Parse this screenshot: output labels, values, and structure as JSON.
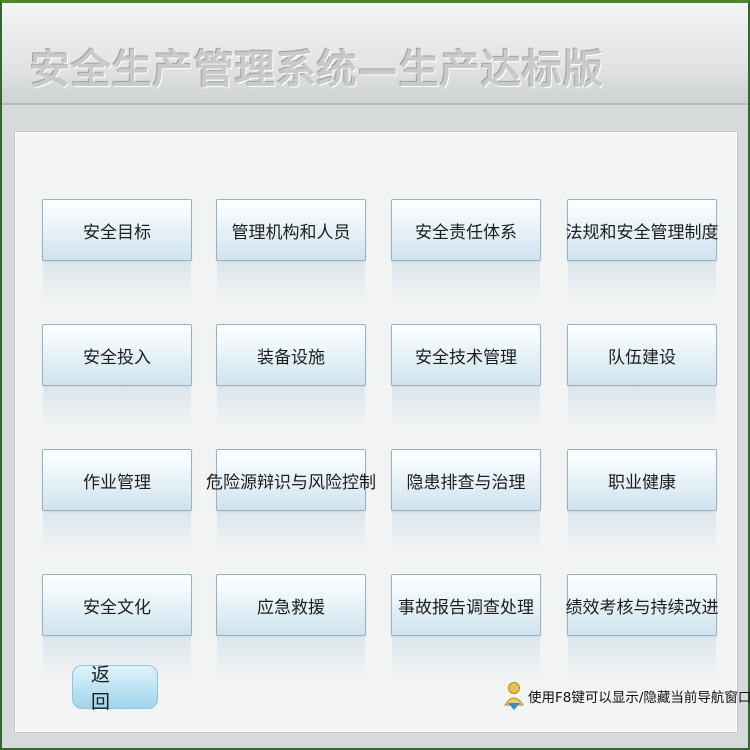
{
  "app": {
    "title": "安全生产管理系统—生产达标版"
  },
  "modules": [
    {
      "label": "安全目标"
    },
    {
      "label": "管理机构和人员"
    },
    {
      "label": "安全责任体系"
    },
    {
      "label": "法规和安全管理制度"
    },
    {
      "label": "安全投入"
    },
    {
      "label": "装备设施"
    },
    {
      "label": "安全技术管理"
    },
    {
      "label": "队伍建设"
    },
    {
      "label": "作业管理"
    },
    {
      "label": "危险源辩识与风险控制"
    },
    {
      "label": "隐患排查与治理"
    },
    {
      "label": "职业健康"
    },
    {
      "label": "安全文化"
    },
    {
      "label": "应急救援"
    },
    {
      "label": "事故报告调查处理"
    },
    {
      "label": "绩效考核与持续改进"
    }
  ],
  "footer": {
    "back_label": "返回",
    "hint_text": "使用F8键可以显示/隐藏当前导航窗口",
    "hint_icon": "user-info-icon"
  },
  "colors": {
    "button_border": "#8fb4c6",
    "button_fill": "#cfe3ee",
    "back_button_fill": "#b7e2f2",
    "frame_border": "#2f6a2a"
  }
}
